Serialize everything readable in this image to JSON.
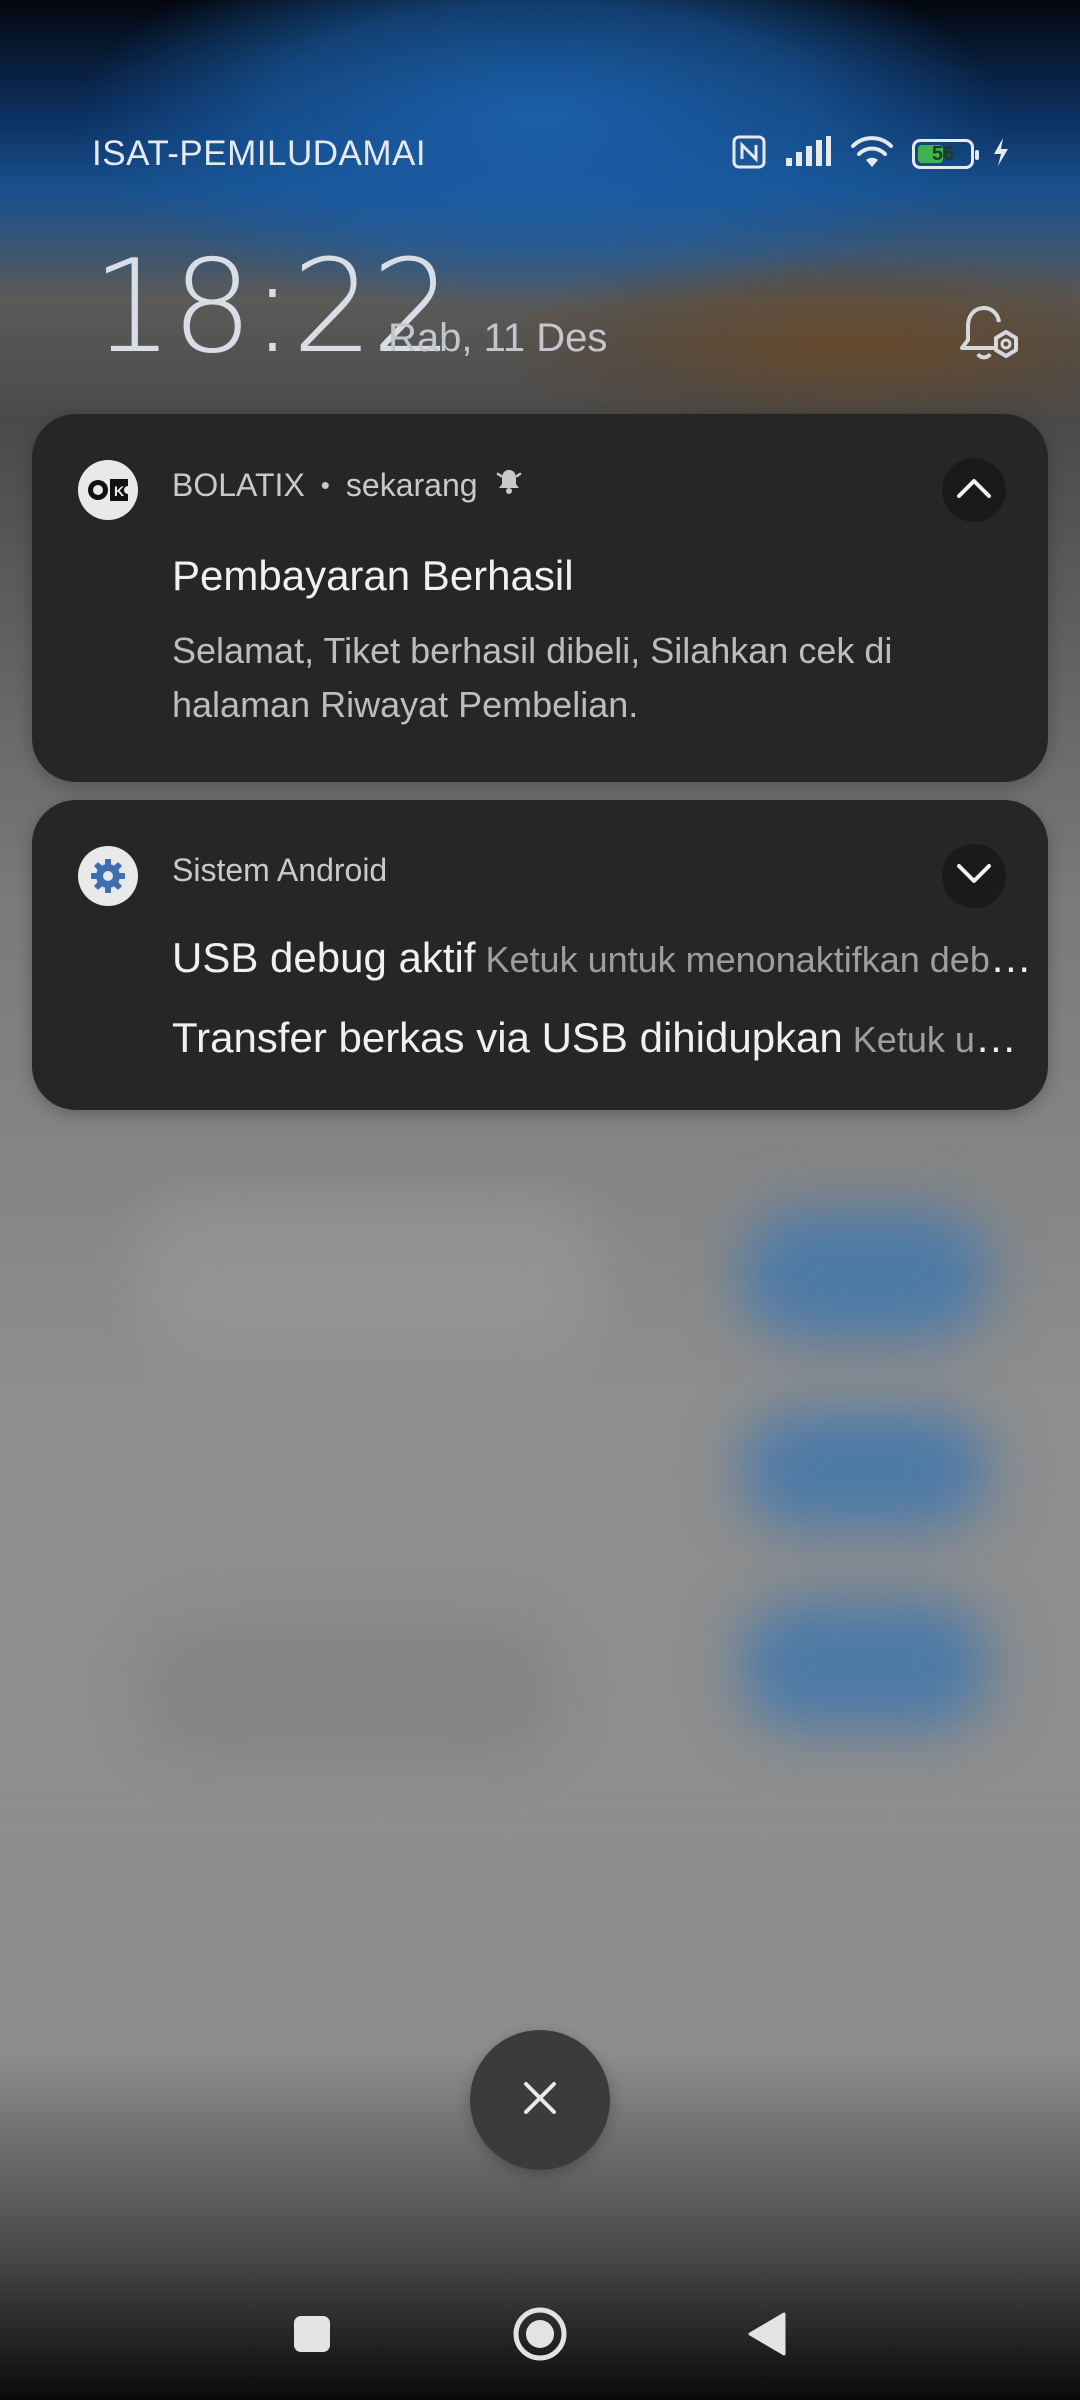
{
  "status_bar": {
    "carrier": "ISAT-PEMILUDAMAI",
    "battery_level": "56",
    "battery_fraction": 0.56,
    "icons": [
      "nfc-icon",
      "signal-icon",
      "wifi-icon",
      "battery-icon",
      "charging-icon"
    ]
  },
  "clock": {
    "time": "18:22",
    "date": "Rab, 11 Des"
  },
  "notifications": [
    {
      "app": "BOLATIX",
      "separator": "•",
      "time": "sekarang",
      "title": "Pembayaran Berhasil",
      "body": "Selamat, Tiket berhasil dibeli, Silahkan cek di halaman Riwayat Pembelian.",
      "expanded": true,
      "icon": "bolatix-logo-icon",
      "alert_icon": "bell-alert-icon"
    },
    {
      "app": "Sistem Android",
      "expanded": false,
      "icon": "android-settings-icon",
      "lines": [
        {
          "title": "USB debug aktif",
          "sub": "Ketuk untuk menonaktifkan debug USB"
        },
        {
          "title": "Transfer berkas via USB dihidupkan",
          "sub": "Ketuk untuk opsi lainnya"
        }
      ]
    }
  ],
  "clear_all_icon": "close-icon",
  "nav": {
    "recent_icon": "square-recent-icon",
    "home_icon": "circle-home-icon",
    "back_icon": "triangle-back-icon"
  },
  "colors": {
    "card_bg": "#262626",
    "battery_fill": "#3fb34f",
    "accent_blue": "#1b5fa8"
  }
}
